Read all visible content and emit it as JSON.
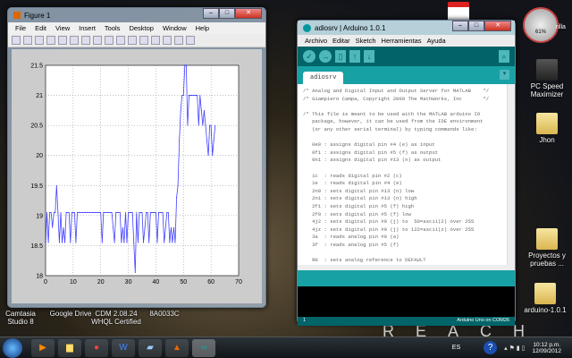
{
  "desktop": {
    "wallpaper_text": "REACH",
    "left_icons": [
      "Camtasia Studio 8",
      "Google Drive",
      "CDM 2.08.24 WHQL Certified",
      "8A0033C"
    ],
    "right_icons": [
      "PC Speed Maximizer",
      "Jhon",
      "Proyectos y pruebas ...",
      "arduino-1.0.1"
    ],
    "partial_label": "rilla",
    "gadget_value": "61%"
  },
  "figure": {
    "title": "Figure 1",
    "menu": [
      "File",
      "Edit",
      "View",
      "Insert",
      "Tools",
      "Desktop",
      "Window",
      "Help"
    ]
  },
  "chart_data": {
    "type": "line",
    "title": "",
    "xlabel": "",
    "ylabel": "",
    "xlim": [
      0,
      70
    ],
    "ylim": [
      18,
      21.5
    ],
    "grid": true,
    "xticks": [
      "0",
      "10",
      "20",
      "30",
      "40",
      "50",
      "60",
      "70"
    ],
    "yticks": [
      "18",
      "18.5",
      "19",
      "19.5",
      "20",
      "20.5",
      "21",
      "21.5"
    ],
    "x_step": 0.5,
    "values": [
      18.55,
      19.05,
      18.55,
      19.05,
      19.05,
      18.8,
      19.05,
      19.05,
      19.5,
      19.05,
      18.55,
      19.05,
      18.55,
      18.8,
      18.55,
      19.05,
      19.05,
      19.05,
      18.55,
      19.05,
      19.05,
      19.05,
      18.55,
      19.05,
      19.05,
      19.05,
      19.05,
      19.05,
      19.05,
      19.05,
      19.05,
      19.05,
      19.05,
      19.05,
      19.05,
      19.05,
      19.05,
      19.05,
      19.05,
      19.05,
      19.05,
      18.55,
      19.05,
      19.05,
      19.05,
      19.05,
      19.05,
      19.05,
      19.05,
      18.8,
      18.55,
      19.05,
      19.05,
      19.05,
      19.05,
      18.55,
      18.8,
      18.55,
      19.05,
      18.55,
      19.05,
      19.05,
      19.05,
      19.05,
      18.55,
      18.05,
      19.05,
      18.55,
      19.05,
      19.05,
      19.05,
      18.55,
      18.8,
      19.05,
      19.05,
      18.55,
      19.05,
      19.05,
      19.05,
      19.05,
      19.05,
      18.55,
      19.05,
      19.05,
      19.05,
      19.05,
      18.55,
      18.8,
      19.05,
      19.05,
      18.55,
      18.8,
      18.55,
      18.8,
      18.55,
      19.3,
      19.5,
      20.25,
      20.75,
      21,
      21,
      21.5,
      21.5,
      20.5,
      21,
      21,
      21,
      21,
      21,
      21,
      21,
      20.5,
      21,
      20.75,
      20.5,
      20.75,
      20.5,
      20.25,
      20.0,
      20.5,
      20.5,
      20.0,
      20.25,
      20.5
    ],
    "color": "#0000ff"
  },
  "arduino": {
    "title": "adiosrv | Arduino 1.0.1",
    "menu": [
      "Archivo",
      "Editar",
      "Sketch",
      "Herramientas",
      "Ayuda"
    ],
    "tab": "adiosrv",
    "code": "/* Analog and Digital Input and Output Server for MATLAB    */\n/* Giampiero Campa, Copyright 2009 The MathWorks, Inc       */\n\n/* This file is meant to be used with the MATLAB arduino IO\n   package, however, it can be used from the IDE environment\n   (or any other serial terminal) by typing commands like:\n\n   0e0 : assigns digital pin #4 (e) as input\n   0f1 : assigns digital pin #5 (f) as output\n   0n1 : assigns digital pin #13 (n) as output\n\n   1c  : reads digital pin #2 (c)\n   1e  : reads digital pin #4 (e)\n   2n0 : sets digital pin #13 (n) low\n   2n1 : sets digital pin #13 (n) high\n   2f1 : sets digital pin #5 (f) high\n   2f0 : sets digital pin #5 (f) low\n   4j2 : sets digital pin #9 (j) to  50=ascii(2) over 255\n   4jz : sets digital pin #9 (j) to 122=ascii(z) over 255\n   3a  : reads analog pin #0 (a)\n   3f  : reads analog pin #5 (f)\n\n   R0  : sets analog reference to DEFAULT",
    "status_line": "1",
    "status_board": "Arduino Uno on COM26"
  },
  "taskbar": {
    "language": "ES",
    "time": "10:12 p.m.",
    "date": "12/09/2012"
  }
}
